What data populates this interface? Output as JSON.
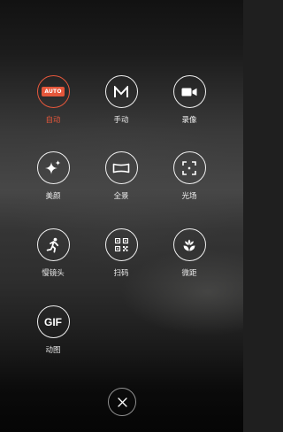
{
  "modes": [
    {
      "id": "auto",
      "label": "自动",
      "icon_text": "AUTO",
      "active": true
    },
    {
      "id": "manual",
      "label": "手动"
    },
    {
      "id": "video",
      "label": "录像"
    },
    {
      "id": "beauty",
      "label": "美颜"
    },
    {
      "id": "panorama",
      "label": "全景"
    },
    {
      "id": "light-field",
      "label": "光场"
    },
    {
      "id": "slow-motion",
      "label": "慢镜头"
    },
    {
      "id": "scan",
      "label": "扫码"
    },
    {
      "id": "macro",
      "label": "微距"
    },
    {
      "id": "gif",
      "label": "动图",
      "icon_text": "GIF"
    }
  ],
  "colors": {
    "accent": "#e5573b",
    "icon": "#ffffff"
  },
  "icons": {
    "auto": "auto-badge-icon",
    "manual": "m-letter-icon",
    "video": "video-camera-icon",
    "beauty": "sparkle-icon",
    "panorama": "panorama-icon",
    "light-field": "focus-frame-icon",
    "slow-motion": "running-person-icon",
    "scan": "qr-code-icon",
    "macro": "flower-icon",
    "gif": "gif-text-icon",
    "close": "close-icon"
  }
}
